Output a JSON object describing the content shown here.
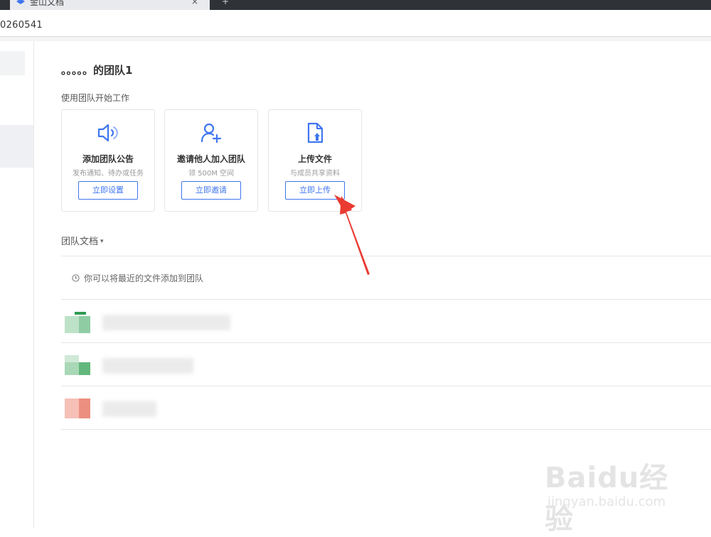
{
  "browser": {
    "tab_title": "金山文档",
    "tab_close": "×",
    "new_tab": "+",
    "address": "0260541"
  },
  "team": {
    "title": "。。。。。的团队1",
    "start_label": "使用团队开始工作"
  },
  "cards": [
    {
      "icon": "speaker-icon",
      "title": "添加团队公告",
      "desc": "发布通知、待办或任务",
      "button": "立即设置"
    },
    {
      "icon": "add-user-icon",
      "title": "邀请他人加入团队",
      "desc": "领 500M 空间",
      "button": "立即邀请"
    },
    {
      "icon": "upload-file-icon",
      "title": "上传文件",
      "desc": "与成员共享资料",
      "button": "立即上传"
    }
  ],
  "docs": {
    "header": "团队文档",
    "caret": "▾",
    "hint": "你可以将最近的文件添加到团队"
  },
  "files": [
    {
      "icon": "spreadsheet-icon",
      "color": "#43a85f"
    },
    {
      "icon": "spreadsheet-icon",
      "color": "#43a85f"
    },
    {
      "icon": "presentation-icon",
      "color": "#e2604a"
    }
  ],
  "colors": {
    "accent": "#3f76f0",
    "annotation_arrow": "#ea3b32"
  },
  "watermark": {
    "main": "Baidu经验",
    "sub": "jingyan.baidu.com"
  }
}
